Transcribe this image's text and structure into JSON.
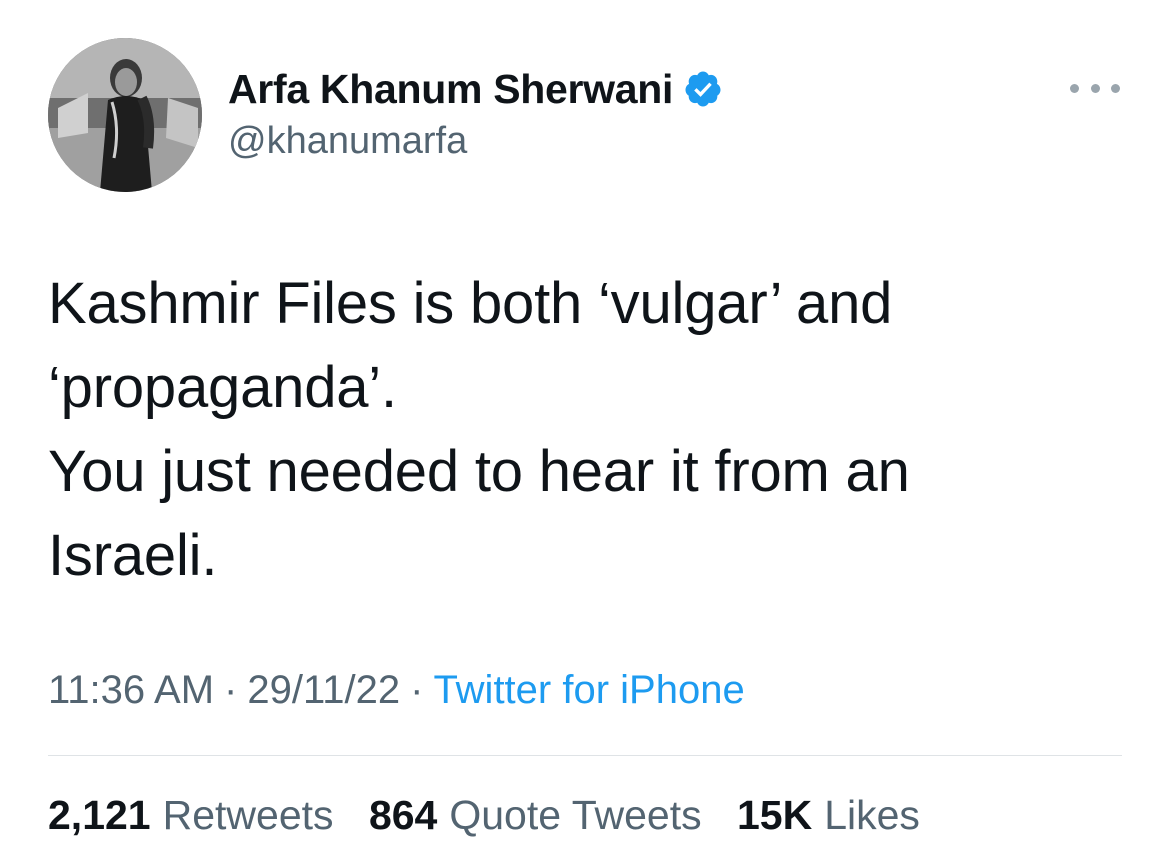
{
  "user": {
    "display_name": "Arfa Khanum Sherwani",
    "handle": "@khanumarfa",
    "verified_icon": "verified-badge-icon",
    "verified_color": "#1d9bf0"
  },
  "tweet": {
    "text": "Kashmir Files is both ‘vulgar’ and\n‘propaganda’.\nYou just needed to hear it from an\nIsraeli.",
    "time": "11:36 AM",
    "date": "29/11/22",
    "source": "Twitter for iPhone",
    "separator": "·"
  },
  "stats": {
    "retweets_count": "2,121",
    "retweets_label": "Retweets",
    "quotes_count": "864",
    "quotes_label": "Quote Tweets",
    "likes_count": "15K",
    "likes_label": "Likes"
  },
  "colors": {
    "text": "#0f1419",
    "secondary": "#536471",
    "link": "#1d9bf0"
  }
}
